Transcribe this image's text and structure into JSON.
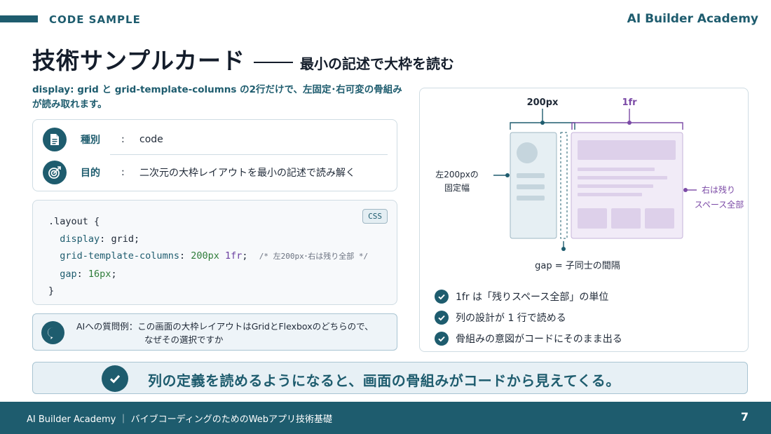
{
  "header": {
    "section_label": "CODE SAMPLE",
    "brand": "AI Builder Academy"
  },
  "title": {
    "main": "技術サンプルカード",
    "sub": "最小の記述で大枠を読む"
  },
  "lead": "display: grid と grid-template-columns の2行だけで、左固定･右可変の骨組みが読み取れます。",
  "info": {
    "rows": [
      {
        "key": "種別",
        "colon": ":",
        "value": "code",
        "icon": "document-icon"
      },
      {
        "key": "目的",
        "colon": ":",
        "value": "二次元の大枠レイアウトを最小の記述で読み解く",
        "icon": "target-icon"
      }
    ]
  },
  "code": {
    "badge": "CSS",
    "l1": ".layout {",
    "l2_prop": "display",
    "l2_val": "grid;",
    "l3_prop": "grid-template-columns",
    "l3_num": "200px",
    "l3_unit": "1fr",
    "l3_semi": ";",
    "l3_comment": "/* 左200px･右は残り全部 */",
    "l4_prop": "gap",
    "l4_num": "16px",
    "l4_semi": ";",
    "l5": "}"
  },
  "question": {
    "line1": "AIへの質問例：この画面の大枠レイアウトはGridとFlexboxのどちらので、",
    "line2": "なぜその選択ですか",
    "icon": "question-bubble-icon"
  },
  "diagram": {
    "label_200px": "200px",
    "label_1fr": "1fr",
    "left_note_1": "左200pxの",
    "left_note_2": "固定幅",
    "right_note_1": "右は残り",
    "right_note_2": "スペース全部",
    "gap_note": "gap = 子同士の間隔"
  },
  "checks": [
    "1fr は「残りスペース全部」の単位",
    "列の設計が 1 行で読める",
    "骨組みの意図がコードにそのまま出る"
  ],
  "summary": "列の定義を読めるようになると、画面の骨組みがコードから見えてくる。",
  "footer": {
    "text": "AI Builder Academy ｜ バイブコーディングのためのWebアプリ技術基礎",
    "page": "7"
  },
  "colors": {
    "primary": "#1e5c6e",
    "accent_purple": "#7b4aa6",
    "panel_fill": "#e6eff3",
    "purple_fill": "#f1ebf7"
  }
}
